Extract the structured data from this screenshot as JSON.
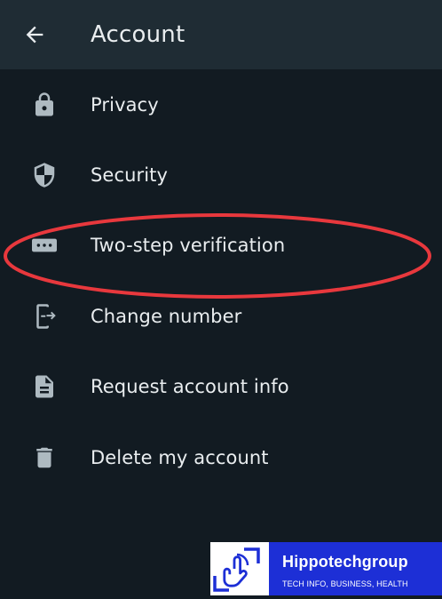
{
  "app_bar": {
    "title": "Account",
    "back_icon": "arrow-back-icon"
  },
  "settings": {
    "items": [
      {
        "label": "Privacy",
        "icon": "lock-icon"
      },
      {
        "label": "Security",
        "icon": "shield-icon"
      },
      {
        "label": "Two-step verification",
        "icon": "password-dots-icon"
      },
      {
        "label": "Change number",
        "icon": "change-number-icon"
      },
      {
        "label": "Request account info",
        "icon": "document-icon"
      },
      {
        "label": "Delete my account",
        "icon": "trash-icon"
      }
    ]
  },
  "annotation": {
    "highlight_color": "#e8383d",
    "highlighted_item": "Two-step verification"
  },
  "watermark": {
    "brand": "Hippotechgroup",
    "tagline": "TECH INFO, BUSINESS, HEALTH",
    "brand_color": "#1d2fd6"
  },
  "colors": {
    "background": "#121b22",
    "app_bar": "#1f2c34",
    "text": "#e9edef",
    "icon": "#aebac1"
  }
}
